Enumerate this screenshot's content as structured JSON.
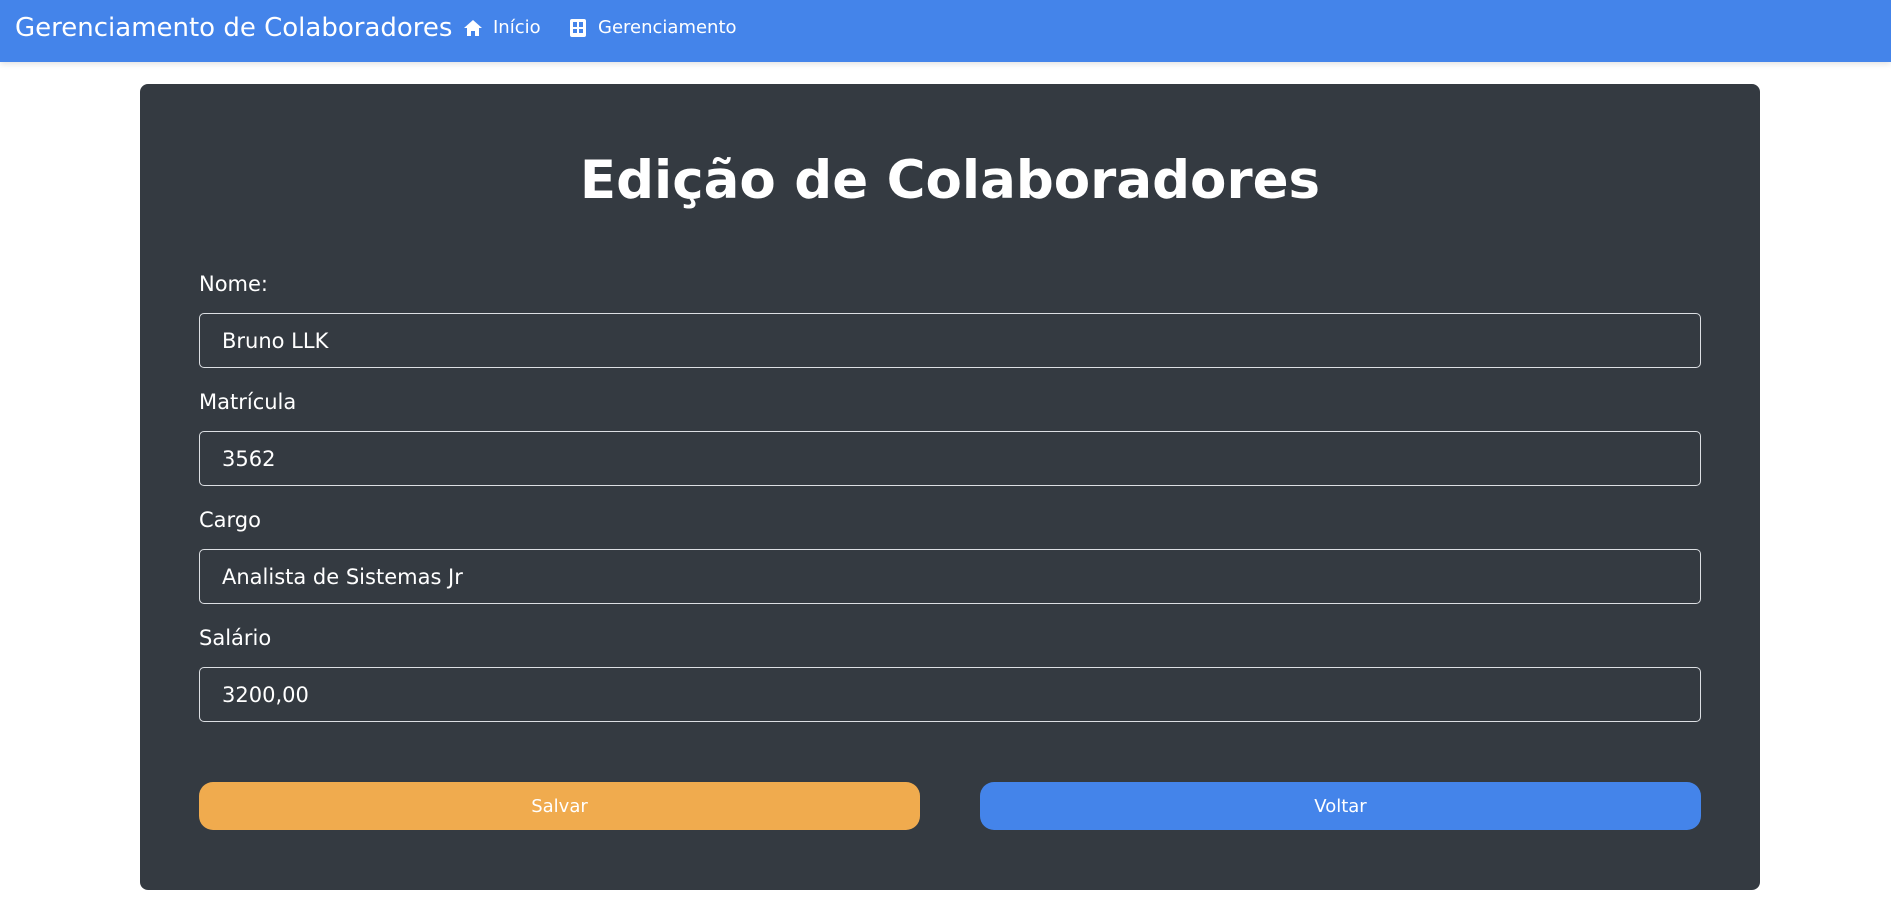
{
  "navbar": {
    "brand": "Gerenciamento de Colaboradores",
    "links": [
      {
        "label": "Início",
        "icon": "home-icon"
      },
      {
        "label": "Gerenciamento",
        "icon": "id-card-icon"
      }
    ]
  },
  "form": {
    "title": "Edição de Colaboradores",
    "fields": [
      {
        "label": "Nome:",
        "value": "Bruno LLK"
      },
      {
        "label": "Matrícula",
        "value": "3562"
      },
      {
        "label": "Cargo",
        "value": "Analista de Sistemas Jr"
      },
      {
        "label": "Salário",
        "value": "3200,00"
      }
    ],
    "save_label": "Salvar",
    "back_label": "Voltar"
  },
  "colors": {
    "navbar": "#4484ea",
    "card": "#343a41",
    "save_button": "#f0ab4e",
    "back_button": "#4484ea"
  }
}
